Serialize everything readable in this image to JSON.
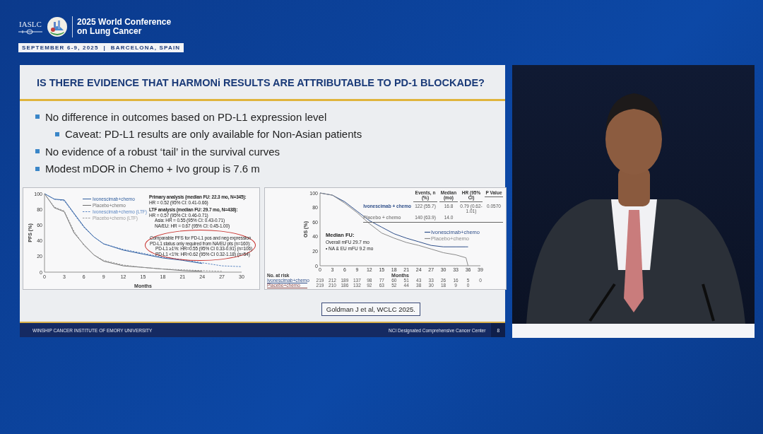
{
  "conference": {
    "org": "IASLC",
    "title_lines": [
      "2025 World Conference",
      "on Lung Cancer"
    ],
    "date_place": "SEPTEMBER 6-9, 2025  |  BARCELONA, SPAIN"
  },
  "slide": {
    "title": "IS THERE EVIDENCE THAT HARMONi RESULTS ARE ATTRIBUTABLE TO PD-1 BLOCKADE?",
    "bullets": [
      {
        "text": "No difference in outcomes based on PD-L1 expression level",
        "children": [
          {
            "text": "Caveat: PD-L1 results are only available for Non-Asian patients"
          }
        ]
      },
      {
        "text": "No evidence of a robust ‘tail’ in the survival curves"
      },
      {
        "text": "Modest mDOR in Chemo + Ivo group is 7.6 m"
      }
    ],
    "pfs_panel": {
      "notes": [
        {
          "kind": "heading",
          "text": "Primary analysis (median FU: 22.3 mo, N=345):"
        },
        {
          "kind": "line",
          "text": "HR = 0.52 (95% CI: 0.41-0.66)"
        },
        {
          "kind": "heading",
          "text": "LTF analysis (median FU: 29.7 mo, N=438):"
        },
        {
          "kind": "line",
          "text": "HR = 0.57 (95% CI: 0.46-0.71)"
        },
        {
          "kind": "sub",
          "text": "Asia: HR = 0.55 (95% CI: 0.43-0.71)"
        },
        {
          "kind": "sub",
          "text": "NA/EU: HR = 0.67 (95% CI: 0.45-1.00)"
        }
      ],
      "circled_notes": [
        {
          "kind": "line",
          "text": "Comparable PFS for PD-L1 pos and neg expression"
        },
        {
          "kind": "line",
          "text": "PD-L1 status only required from NA/EU pts (n=160):"
        },
        {
          "kind": "sub",
          "text": "PD-L1 ≥1%: HR=0.55 (95% CI 0.33-0.91) (n=106)"
        },
        {
          "kind": "sub",
          "text": "PD-L1 <1%: HR=0.62 (95% CI 0.32-1.18) (n=54)"
        }
      ],
      "chart_data": {
        "type": "line",
        "xlabel": "Months",
        "ylabel": "PFS (%)",
        "legend": "upper center",
        "x": [
          0,
          1.5,
          3,
          4.5,
          6,
          7.5,
          9,
          12,
          15,
          18,
          21,
          24,
          27,
          30
        ],
        "xlim": [
          0,
          30
        ],
        "ylim": [
          0,
          100
        ],
        "xticks": [
          0,
          3,
          6,
          9,
          12,
          15,
          18,
          21,
          24,
          27,
          30
        ],
        "yticks": [
          0,
          20,
          40,
          60,
          80,
          100
        ],
        "series": [
          {
            "name": "Ivonescimab+chemo",
            "color": "#2f5d9e",
            "values": [
              100,
              93,
              92,
              75,
              58,
              45,
              36,
              28,
              23,
              18,
              15,
              11,
              null,
              null
            ]
          },
          {
            "name": "Placebo+chemo",
            "color": "#6e6e6e",
            "values": [
              100,
              82,
              77,
              50,
              35,
              22,
              14,
              8,
              6,
              4,
              2,
              1,
              null,
              null
            ]
          },
          {
            "name": "Ivonescimab+chemo (LTF)",
            "color": "#5b86c2",
            "line_style": "dashed",
            "values": [
              100,
              93,
              91,
              74,
              57,
              45,
              36,
              29,
              24,
              19,
              16,
              12,
              8,
              7
            ]
          },
          {
            "name": "Placebo+chemo (LTF)",
            "color": "#9a9a9a",
            "line_style": "dashed",
            "values": [
              100,
              83,
              78,
              52,
              34,
              22,
              15,
              9,
              6,
              4,
              3,
              2,
              1,
              null
            ]
          }
        ]
      }
    },
    "os_panel": {
      "table": {
        "columns": [
          "Events, n (%)",
          "Median (mo)",
          "HR (95% CI)",
          "P Value"
        ],
        "rows": [
          {
            "label": "Ivonescimab + chemo",
            "cells": [
              "122 (55.7)",
              "16.8",
              "0.79 (0.62-1.01)",
              "0.0570"
            ]
          },
          {
            "label": "Placebo + chemo",
            "cells": [
              "140 (63.9)",
              "14.0"
            ]
          }
        ]
      },
      "median_fu": {
        "title": "Median FU:",
        "lines": [
          "Overall mFU 29.7 mo",
          "• NA & EU mFU 9.2 mo"
        ]
      },
      "chart_data": {
        "type": "line",
        "xlabel": "Months",
        "ylabel": "OS (%)",
        "legend": "center right",
        "x": [
          0,
          3,
          6,
          9,
          12,
          15,
          18,
          21,
          24,
          27,
          30,
          33,
          35.5,
          36
        ],
        "xlim": [
          0,
          39
        ],
        "ylim": [
          0,
          100
        ],
        "xticks": [
          0,
          3,
          6,
          9,
          12,
          15,
          18,
          21,
          24,
          27,
          30,
          33,
          36,
          39
        ],
        "yticks": [
          0,
          20,
          40,
          60,
          80,
          100
        ],
        "series": [
          {
            "name": "Ivonescimab+chemo",
            "color": "#2f4f8a",
            "values": [
              100,
              97,
              88,
              75,
              62,
              53,
              44,
              38,
              33,
              28,
              26,
              26,
              26,
              26
            ]
          },
          {
            "name": "Placebo+chemo",
            "color": "#8a8a8a",
            "values": [
              100,
              97,
              86,
              73,
              58,
              45,
              38,
              32,
              28,
              23,
              18,
              15,
              11,
              0
            ]
          }
        ]
      },
      "risk_table": {
        "title": "No. at risk",
        "rows": [
          {
            "label": "Ivonescimab+chemo",
            "color": "#2f4f8a",
            "values": [
              "219",
              "212",
              "189",
              "137",
              "98",
              "77",
              "60",
              "51",
              "43",
              "33",
              "26",
              "16",
              "5",
              "0"
            ]
          },
          {
            "label": "Placebo+chemo",
            "color": "#8a4a4a",
            "values": [
              "219",
              "210",
              "186",
              "132",
              "92",
              "63",
              "52",
              "44",
              "38",
              "30",
              "18",
              "9",
              "0"
            ]
          }
        ]
      }
    },
    "citation": "Goldman J et al, WCLC 2025.",
    "footer": {
      "left": "WINSHIP CANCER INSTITUTE OF EMORY UNIVERSITY",
      "right": "NCI Designated Comprehensive Cancer Center",
      "page": "8"
    }
  }
}
